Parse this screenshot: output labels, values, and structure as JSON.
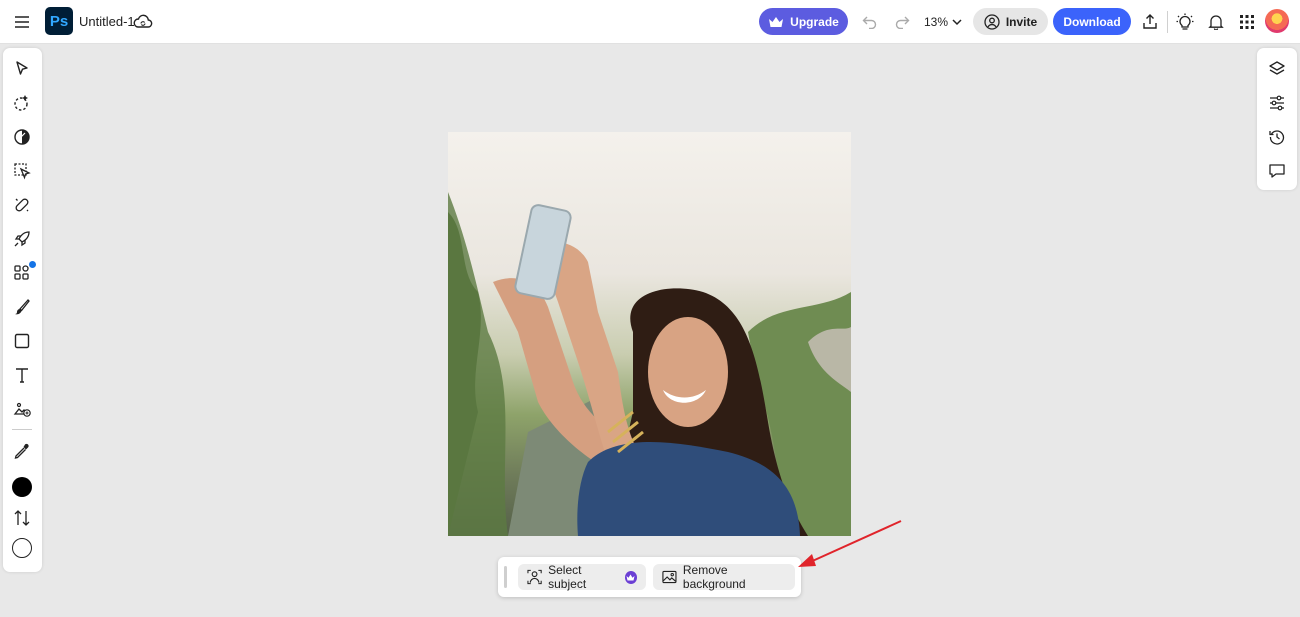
{
  "topbar": {
    "app_logo_text": "Ps",
    "document_title": "Untitled-1",
    "upgrade_label": "Upgrade",
    "zoom_level": "13%",
    "invite_label": "Invite",
    "download_label": "Download"
  },
  "left_toolbar": {
    "tools": [
      "move-tool",
      "quick-selection-tool",
      "adjust-tool",
      "object-selection-tool",
      "healing-tool",
      "quick-actions-tool",
      "add-ons-tool",
      "brush-tool",
      "shape-tool",
      "type-tool",
      "add-image-tool",
      "eyedropper-tool",
      "foreground-color",
      "swap-colors",
      "background-color"
    ],
    "foreground_color": "#000000",
    "background_color": "#ffffff"
  },
  "right_toolbar": {
    "tools": [
      "layers-icon",
      "adjustments-icon",
      "history-icon",
      "comments-icon"
    ]
  },
  "canvas": {
    "image_description_icon": "photo-canvas"
  },
  "context_taskbar": {
    "select_subject_label": "Select subject",
    "remove_background_label": "Remove background"
  },
  "colors": {
    "accent_upgrade": "#5c5ce0",
    "accent_download": "#3b63fb",
    "annotation_arrow": "#e0242b",
    "ps_logo_bg": "#001e36",
    "ps_logo_text": "#31a8ff"
  }
}
